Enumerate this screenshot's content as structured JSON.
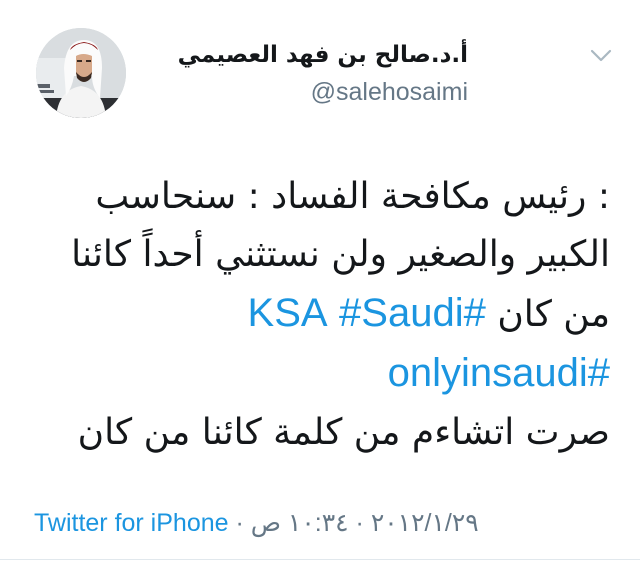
{
  "tweet": {
    "display_name": "أ.د.صالح بن فهد العصيمي",
    "handle": "@salehosaimi",
    "body": {
      "line1": ": رئيس مكافحة الفساد : سنحاسب",
      "line2": "الكبير والصغير ولن نستثني أحداً كائنا",
      "line3_text": "من كان",
      "hashtag_ksa": "#KSA",
      "hashtag_saudi": "#Saudi",
      "hashtag_onlyinsaudi": "#onlyinsaudi",
      "line5": "صرت اتشاءم من كلمة كائنا من كان"
    },
    "footer": {
      "source": "Twitter for iPhone",
      "separator": " · ",
      "date": "٢٠١٢/١/٢٩",
      "time": "١٠:٣٤ ص"
    }
  },
  "icons": {
    "menu_chevron": "chevron-down-icon",
    "avatar": "profile-photo"
  },
  "colors": {
    "link": "#1b95e0",
    "secondary_text": "#657786",
    "primary_text": "#14171a",
    "divider": "#e1e8ed"
  }
}
